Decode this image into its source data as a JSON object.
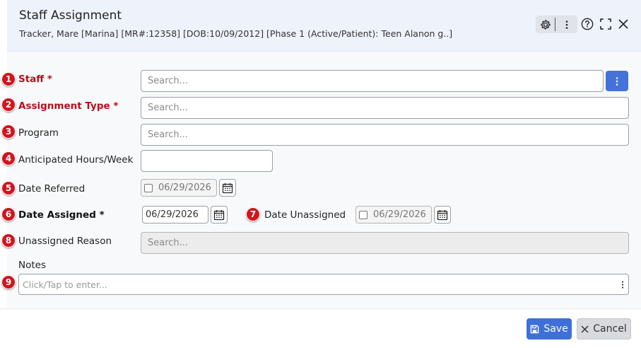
{
  "header": {
    "title": "Staff Assignment",
    "subtitle": "Tracker, Mare [Marina] [MR#:12358] [DOB:10/09/2012] [Phase 1 (Active/Patient): Teen Alanon g..]",
    "tools": [
      "gear-icon",
      "more-vertical-icon",
      "help-icon",
      "expand-icon",
      "close-icon"
    ]
  },
  "form": {
    "staff": {
      "badge": "1",
      "label": "Staff *",
      "placeholder": "Search..."
    },
    "assignment_type": {
      "badge": "2",
      "label": "Assignment Type *",
      "placeholder": "Search..."
    },
    "program": {
      "badge": "3",
      "label": "Program",
      "placeholder": "Search..."
    },
    "anticipated_hours": {
      "badge": "4",
      "label": "Anticipated Hours/Week",
      "value": ""
    },
    "date_referred": {
      "badge": "5",
      "label": "Date Referred",
      "value": "06/29/2026",
      "checked": false
    },
    "date_assigned": {
      "badge": "6",
      "label": "Date Assigned *",
      "value": "06/29/2026"
    },
    "date_unassigned": {
      "badge": "7",
      "label": "Date Unassigned",
      "value": "06/29/2026",
      "checked": false
    },
    "unassigned_reason": {
      "badge": "8",
      "label": "Unassigned Reason",
      "placeholder": "Search..."
    },
    "notes": {
      "badge": "9",
      "label": "Notes",
      "placeholder": "Click/Tap to enter..."
    }
  },
  "footer": {
    "save_label": "Save",
    "cancel_label": "Cancel"
  },
  "colors": {
    "header_bg": "#eef2fb",
    "badge": "#d2141e",
    "required_label": "#b80f1b",
    "primary_button": "#3f6fd8",
    "secondary_button": "#d9dadd"
  }
}
